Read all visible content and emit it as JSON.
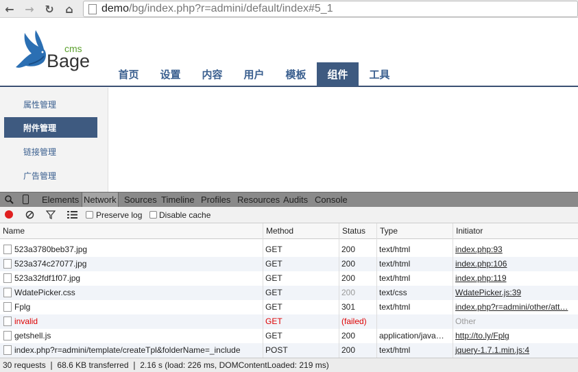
{
  "browser": {
    "url_host": "demo",
    "url_path": "/bg/index.php?r=admini/default/index#5_1"
  },
  "site": {
    "logo_small": "cms",
    "logo_big": "Bage",
    "nav": [
      "首页",
      "设置",
      "内容",
      "用户",
      "模板",
      "组件",
      "工具"
    ],
    "active_nav": "组件"
  },
  "sidebar": {
    "items": [
      "属性管理",
      "附件管理",
      "链接管理",
      "广告管理"
    ]
  },
  "devtools": {
    "tabs": [
      "Elements",
      "Network",
      "Sources",
      "Timeline",
      "Profiles",
      "Resources",
      "Audits",
      "Console"
    ],
    "active_tab": "Network",
    "preserve_log": "Preserve log",
    "disable_cache": "Disable cache",
    "columns": [
      "Name",
      "Method",
      "Status",
      "Type",
      "Initiator"
    ],
    "rows": [
      {
        "name": "523a3780beb37.jpg",
        "method": "GET",
        "status": "200",
        "type": "text/html",
        "initiator": "index.php:93"
      },
      {
        "name": "523a374c27077.jpg",
        "method": "GET",
        "status": "200",
        "type": "text/html",
        "initiator": "index.php:106"
      },
      {
        "name": "523a32fdf1f07.jpg",
        "method": "GET",
        "status": "200",
        "type": "text/html",
        "initiator": "index.php:119"
      },
      {
        "name": "WdatePicker.css",
        "method": "GET",
        "status": "200",
        "type": "text/css",
        "initiator": "WdatePicker.js:39"
      },
      {
        "name": "Fplg",
        "method": "GET",
        "status": "301",
        "type": "text/html",
        "initiator": "index.php?r=admini/other/att…"
      },
      {
        "name": "invalid",
        "method": "GET",
        "status": "(failed)",
        "type": "",
        "initiator": "Other"
      },
      {
        "name": "getshell.js",
        "method": "GET",
        "status": "200",
        "type": "application/java…",
        "initiator": "http://to.ly/Fplg"
      },
      {
        "name": "index.php?r=admini/template/createTpl&folderName=_include",
        "method": "POST",
        "status": "200",
        "type": "text/html",
        "initiator": "jquery-1.7.1.min.js:4"
      }
    ],
    "summary": "30 requests ❘ 68.6 KB transferred ❘ 2.16 s (load: 226 ms, DOMContentLoaded: 219 ms)"
  }
}
